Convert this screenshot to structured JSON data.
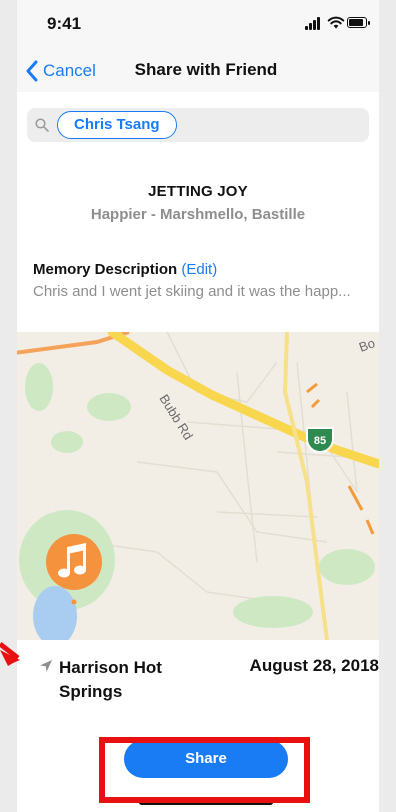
{
  "status_bar": {
    "time": "9:41"
  },
  "nav": {
    "cancel_label": "Cancel",
    "title": "Share with Friend"
  },
  "search": {
    "recipient": "Chris Tsang"
  },
  "song": {
    "title": "JETTING JOY",
    "artist": "Happier - Marshmello, Bastille"
  },
  "memory": {
    "label": "Memory Description",
    "edit_label": "(Edit)",
    "text": "Chris and I went jet skiing and it was the happ..."
  },
  "map": {
    "road_label": "Bubb Rd",
    "highway_number": "85",
    "corner_label": "Bo"
  },
  "location": {
    "name": "Harrison Hot Springs",
    "date": "August 28, 2018"
  },
  "share": {
    "label": "Share"
  },
  "colors": {
    "accent": "#1a7cf5",
    "annotation": "#e81010",
    "pin": "#f5923e"
  },
  "icons": {
    "back": "chevron-left-icon",
    "search": "search-icon",
    "location": "location-arrow-icon",
    "pin": "music-note-icon"
  }
}
